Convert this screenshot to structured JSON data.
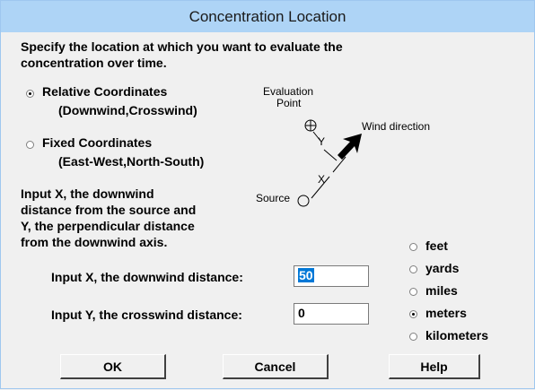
{
  "window": {
    "title": "Concentration Location"
  },
  "instructions": {
    "line1": "Specify the location at which you want to evaluate the",
    "line2": "concentration over time."
  },
  "coord_options": [
    {
      "line1": "Relative Coordinates",
      "line2": "(Downwind,Crosswind)",
      "selected": true
    },
    {
      "line1": "Fixed Coordinates",
      "line2": "(East-West,North-South)",
      "selected": false
    }
  ],
  "diagram": {
    "eval_line1": "Evaluation",
    "eval_line2": "Point",
    "y_label": "Y",
    "x_label": "X",
    "wind_label": "Wind direction",
    "source_label": "Source"
  },
  "help_text": {
    "line1": "Input X, the downwind",
    "line2": "distance from the source and",
    "line3": "Y, the perpendicular distance",
    "line4": "from the downwind axis."
  },
  "fields": {
    "x_label": "Input X, the downwind distance:",
    "x_value": "50",
    "y_label": "Input Y, the crosswind distance:",
    "y_value": "0"
  },
  "units": [
    {
      "label": "feet",
      "selected": false
    },
    {
      "label": "yards",
      "selected": false
    },
    {
      "label": "miles",
      "selected": false
    },
    {
      "label": "meters",
      "selected": true
    },
    {
      "label": "kilometers",
      "selected": false
    }
  ],
  "buttons": {
    "ok": "OK",
    "cancel": "Cancel",
    "help": "Help"
  }
}
